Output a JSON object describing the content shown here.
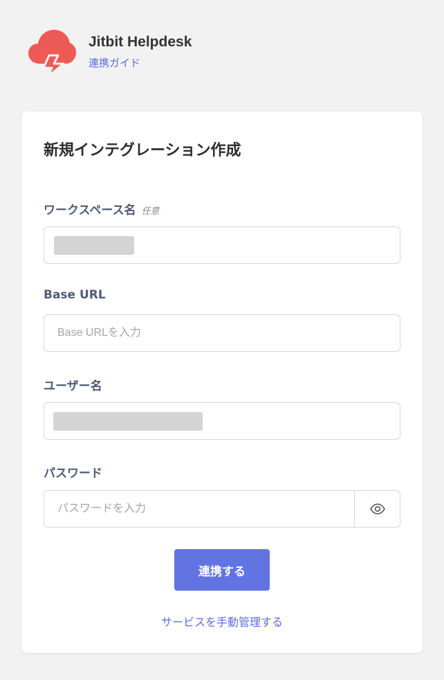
{
  "header": {
    "app_name": "Jitbit Helpdesk",
    "guide_link": "連携ガイド"
  },
  "form": {
    "title": "新規インテグレーション作成",
    "workspace": {
      "label": "ワークスペース名",
      "optional": "任意",
      "value": ""
    },
    "base_url": {
      "label": "Base URL",
      "placeholder": "Base URLを入力"
    },
    "username": {
      "label": "ユーザー名",
      "value": ""
    },
    "password": {
      "label": "パスワード",
      "placeholder": "パスワードを入力"
    },
    "submit_label": "連携する",
    "manual_link": "サービスを手動管理する"
  },
  "colors": {
    "accent": "#6273e2",
    "logo": "#ee5a55",
    "background": "#f2f2f2"
  },
  "icons": {
    "logo": "cloud-lightning-icon",
    "password_toggle": "eye-icon"
  }
}
